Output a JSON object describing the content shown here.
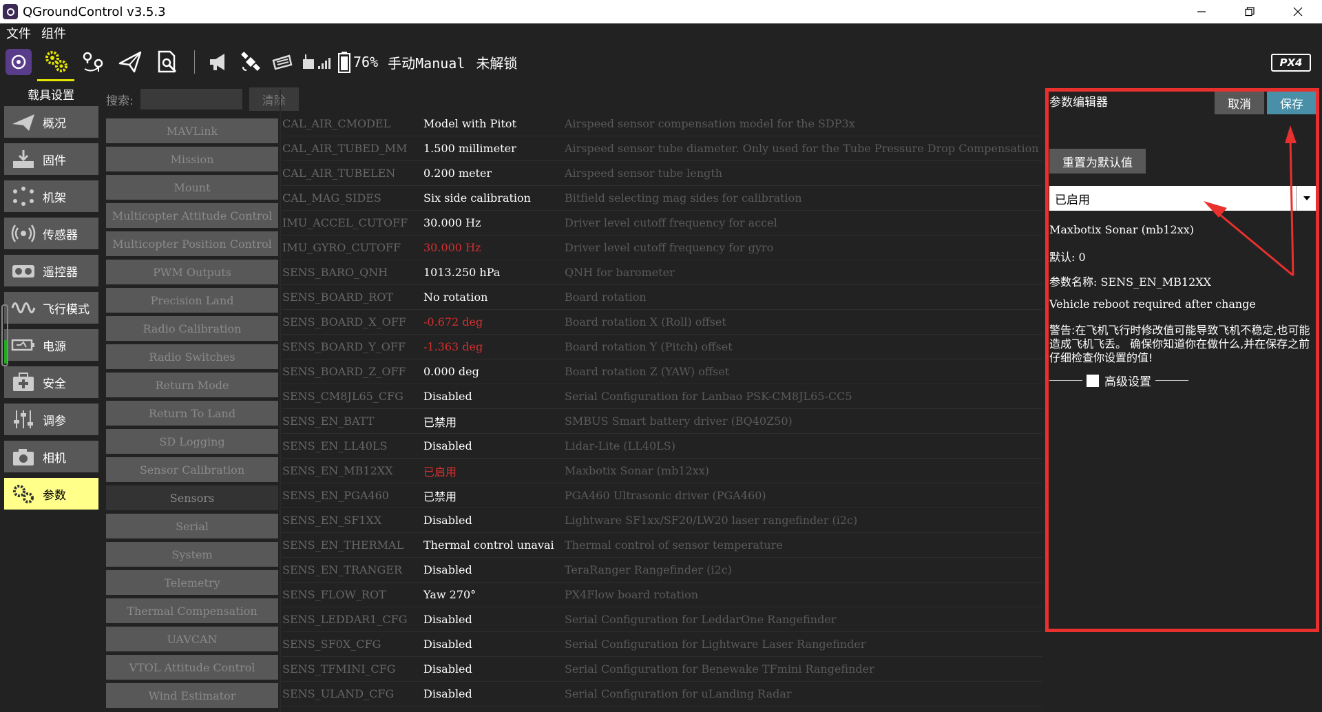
{
  "window": {
    "title": "QGroundControl v3.5.3"
  },
  "menu": [
    "文件",
    "组件"
  ],
  "toolbar": {
    "battery": "76%",
    "mode": "手动Manual",
    "arm_status": "未解锁",
    "logo": "PX4"
  },
  "sidebar": {
    "title": "载具设置",
    "items": [
      {
        "label": "概况",
        "icon": "plane-icon"
      },
      {
        "label": "固件",
        "icon": "download-icon"
      },
      {
        "label": "机架",
        "icon": "airframe-icon"
      },
      {
        "label": "传感器",
        "icon": "radio-waves-icon"
      },
      {
        "label": "遥控器",
        "icon": "remote-controller-icon"
      },
      {
        "label": "飞行模式",
        "icon": "wave-icon"
      },
      {
        "label": "电源",
        "icon": "battery-icon"
      },
      {
        "label": "安全",
        "icon": "medkit-icon"
      },
      {
        "label": "调参",
        "icon": "sliders-icon"
      },
      {
        "label": "相机",
        "icon": "camera-icon"
      },
      {
        "label": "参数",
        "icon": "gears-icon"
      }
    ]
  },
  "search": {
    "label": "搜索:",
    "clear": "清除"
  },
  "groups": [
    "MAVLink",
    "Mission",
    "Mount",
    "Multicopter Attitude Control",
    "Multicopter Position Control",
    "PWM Outputs",
    "Precision Land",
    "Radio Calibration",
    "Radio Switches",
    "Return Mode",
    "Return To Land",
    "SD Logging",
    "Sensor Calibration",
    "Sensors",
    "Serial",
    "System",
    "Telemetry",
    "Thermal Compensation",
    "UAVCAN",
    "VTOL Attitude Control",
    "Wind Estimator"
  ],
  "params": [
    {
      "name": "CAL_AIR_CMODEL",
      "value": "Model with Pitot",
      "desc": "Airspeed sensor compensation model for the SDP3x",
      "mod": false
    },
    {
      "name": "CAL_AIR_TUBED_MM",
      "value": "1.500 millimeter",
      "desc": "Airspeed sensor tube diameter. Only used for the Tube Pressure Drop Compensation",
      "mod": false
    },
    {
      "name": "CAL_AIR_TUBELEN",
      "value": "0.200 meter",
      "desc": "Airspeed sensor tube length",
      "mod": false
    },
    {
      "name": "CAL_MAG_SIDES",
      "value": "Six side calibration",
      "desc": "Bitfield selecting mag sides for calibration",
      "mod": false
    },
    {
      "name": "IMU_ACCEL_CUTOFF",
      "value": "30.000 Hz",
      "desc": "Driver level cutoff frequency for accel",
      "mod": false
    },
    {
      "name": "IMU_GYRO_CUTOFF",
      "value": "30.000 Hz",
      "desc": "Driver level cutoff frequency for gyro",
      "mod": true
    },
    {
      "name": "SENS_BARO_QNH",
      "value": "1013.250 hPa",
      "desc": "QNH for barometer",
      "mod": false
    },
    {
      "name": "SENS_BOARD_ROT",
      "value": "No rotation",
      "desc": "Board rotation",
      "mod": false
    },
    {
      "name": "SENS_BOARD_X_OFF",
      "value": "-0.672 deg",
      "desc": "Board rotation X (Roll) offset",
      "mod": true
    },
    {
      "name": "SENS_BOARD_Y_OFF",
      "value": "-1.363 deg",
      "desc": "Board rotation Y (Pitch) offset",
      "mod": true
    },
    {
      "name": "SENS_BOARD_Z_OFF",
      "value": "0.000 deg",
      "desc": "Board rotation Z (YAW) offset",
      "mod": false
    },
    {
      "name": "SENS_CM8JL65_CFG",
      "value": "Disabled",
      "desc": "Serial Configuration for Lanbao PSK-CM8JL65-CC5",
      "mod": false
    },
    {
      "name": "SENS_EN_BATT",
      "value": "已禁用",
      "desc": "SMBUS Smart battery driver (BQ40Z50)",
      "mod": false
    },
    {
      "name": "SENS_EN_LL40LS",
      "value": "Disabled",
      "desc": "Lidar-Lite (LL40LS)",
      "mod": false
    },
    {
      "name": "SENS_EN_MB12XX",
      "value": "已启用",
      "desc": "Maxbotix Sonar (mb12xx)",
      "mod": true
    },
    {
      "name": "SENS_EN_PGA460",
      "value": "已禁用",
      "desc": "PGA460 Ultrasonic driver (PGA460)",
      "mod": false
    },
    {
      "name": "SENS_EN_SF1XX",
      "value": "Disabled",
      "desc": "Lightware SF1xx/SF20/LW20 laser rangefinder (i2c)",
      "mod": false
    },
    {
      "name": "SENS_EN_THERMAL",
      "value": "Thermal control unavai",
      "desc": "Thermal control of sensor temperature",
      "mod": false
    },
    {
      "name": "SENS_EN_TRANGER",
      "value": "Disabled",
      "desc": "TeraRanger Rangefinder (i2c)",
      "mod": false
    },
    {
      "name": "SENS_FLOW_ROT",
      "value": "Yaw 270°",
      "desc": "PX4Flow board rotation",
      "mod": false
    },
    {
      "name": "SENS_LEDDAR1_CFG",
      "value": "Disabled",
      "desc": "Serial Configuration for LeddarOne Rangefinder",
      "mod": false
    },
    {
      "name": "SENS_SF0X_CFG",
      "value": "Disabled",
      "desc": "Serial Configuration for Lightware Laser Rangefinder",
      "mod": false
    },
    {
      "name": "SENS_TFMINI_CFG",
      "value": "Disabled",
      "desc": "Serial Configuration for Benewake TFmini Rangefinder",
      "mod": false
    },
    {
      "name": "SENS_ULAND_CFG",
      "value": "Disabled",
      "desc": "Serial Configuration for uLanding Radar",
      "mod": false
    }
  ],
  "editor": {
    "title": "参数编辑器",
    "cancel": "取消",
    "save": "保存",
    "reset": "重置为默认值",
    "selected_value": "已启用",
    "description": "Maxbotix Sonar (mb12xx)",
    "default": "默认:  0",
    "param_name": "参数名称:  SENS_EN_MB12XX",
    "reboot_note": "Vehicle reboot required after change",
    "warning": "警告:在飞机飞行时修改值可能导致飞机不稳定,也可能造成飞机飞丢。 确保你知道你在做什么,并在保存之前仔细检查你设置的值!",
    "advanced": "高级设置"
  },
  "colors": {
    "accent_yellow": "#ffff8a",
    "highlight_red": "#e8302e",
    "modified": "#d43030"
  }
}
